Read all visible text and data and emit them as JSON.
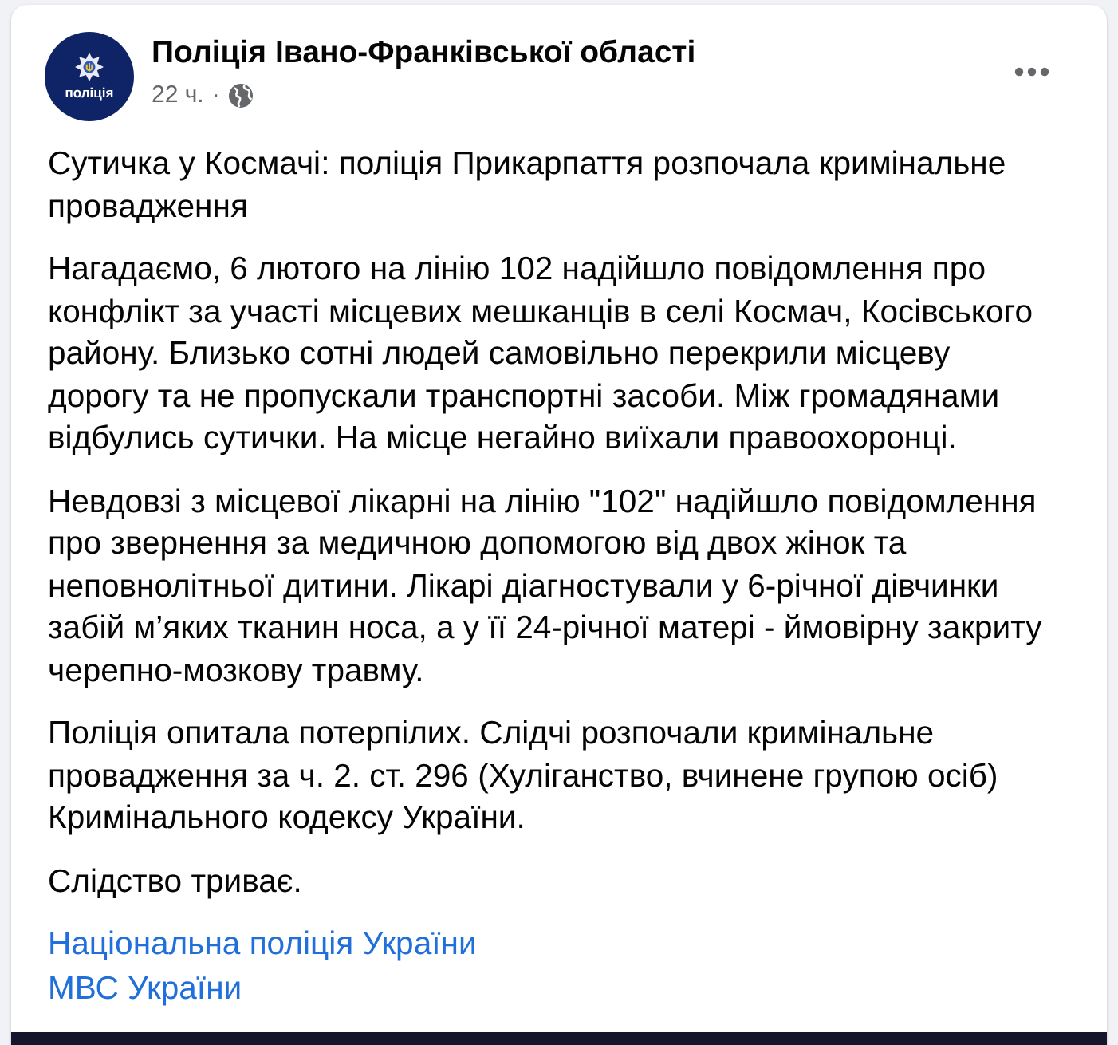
{
  "post": {
    "author": "Поліція Івано-Франківської області",
    "avatar_text": "поліція",
    "time": "22 ч.",
    "separator": "·"
  },
  "paragraphs": [
    {
      "lines": [
        "Сутичка у Космачі: поліція Прикарпаття розпочала кримінальне",
        "провадження"
      ]
    },
    {
      "lines": [
        "Нагадаємо, 6 лютого на лінію 102 надійшло повідомлення про",
        "конфлікт за участі місцевих мешканців в селі Космач, Косівського",
        "району. Близько сотні людей самовільно перекрили місцеву",
        "дорогу та не пропускали транспортні засоби. Між громадянами",
        "відбулись сутички. На місце негайно виїхали правоохоронці."
      ]
    },
    {
      "lines": [
        "Невдовзі з місцевої лікарні на лінію \"102\" надійшло повідомлення",
        "про звернення за медичною допомогою від двох жінок та",
        "неповнолітньої дитини. Лікарі діагностували у 6-річної дівчинки",
        "забій м’яких тканин носа, а у її 24-річної матері - ймовірну закриту",
        "черепно-мозкову травму."
      ]
    },
    {
      "lines": [
        "Поліція опитала потерпілих. Слідчі розпочали кримінальне",
        "провадження за ч. 2. ст. 296 (Хуліганство, вчинене групою осіб)",
        "Кримінального кодексу України."
      ]
    },
    {
      "lines": [
        "Слідство триває."
      ]
    }
  ],
  "links": [
    "Національна поліція України",
    "МВС України"
  ]
}
